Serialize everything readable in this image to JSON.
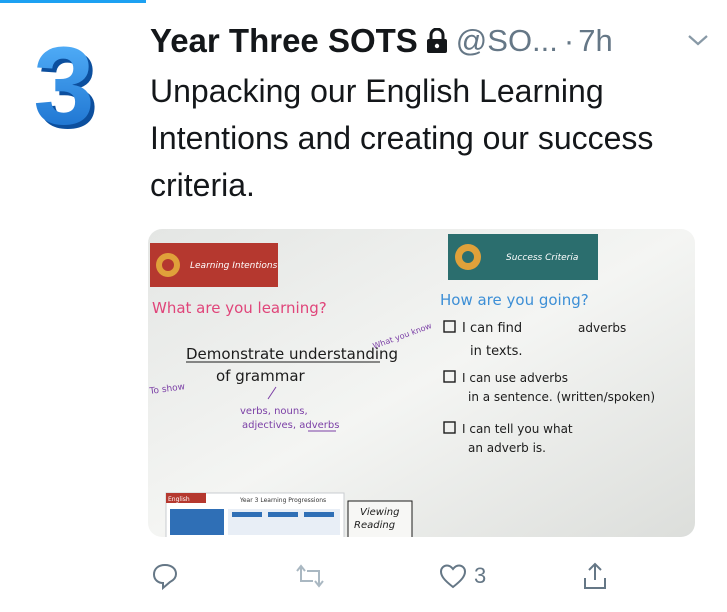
{
  "tweet": {
    "display_name": "Year Three SOTS",
    "handle": "@SO...",
    "separator": "·",
    "time": "7h",
    "text": "Unpacking our English Learning Intentions and creating our success criteria.",
    "avatar_glyph": "3"
  },
  "media": {
    "left_banner": "Learning Intentions",
    "right_banner": "Success Criteria",
    "left_question": "What are you learning?",
    "right_question": "How are you going?",
    "side_note": "What you know",
    "to_show": "To show",
    "main_line1": "Demonstrate understanding",
    "main_line2": "of grammar",
    "sub_line1": "verbs, nouns,",
    "sub_line2": "adjectives, adverbs",
    "criteria": [
      {
        "line1": "I can find",
        "extra": "adverbs",
        "line2": "in texts."
      },
      {
        "line1": "I can use adverbs",
        "extra": "",
        "line2": "in a sentence. (written/spoken)"
      },
      {
        "line1": "I can tell you what",
        "extra": "",
        "line2": "an adverb is."
      }
    ],
    "poster_title": "Year 3 Learning Progressions",
    "poster_tag": "English",
    "viewing_note1": "Viewing",
    "viewing_note2": "Reading"
  },
  "actions": {
    "like_count": "3"
  },
  "colors": {
    "accent": "#1da1f2",
    "banner_left": "#b5382f",
    "banner_right": "#2b6e6e",
    "marker_pink": "#e0457a",
    "marker_blue": "#3d8fd6",
    "marker_purple": "#7b3fa6"
  }
}
